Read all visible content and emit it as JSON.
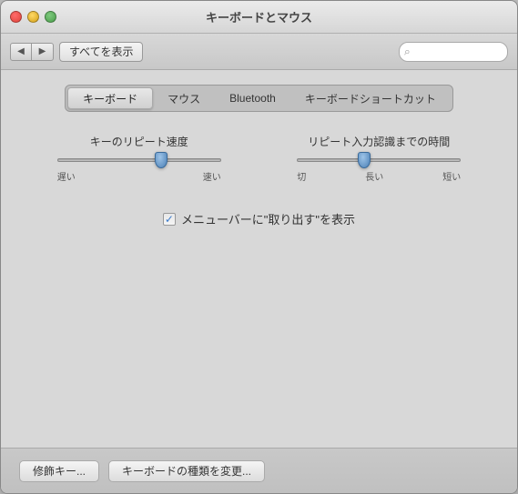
{
  "window": {
    "title": "キーボードとマウス"
  },
  "toolbar": {
    "show_all_label": "すべてを表示",
    "back_label": "◀",
    "forward_label": "▶",
    "search_placeholder": ""
  },
  "tabs": [
    {
      "id": "keyboard",
      "label": "キーボード",
      "active": true
    },
    {
      "id": "mouse",
      "label": "マウス",
      "active": false
    },
    {
      "id": "bluetooth",
      "label": "Bluetooth",
      "active": false
    },
    {
      "id": "shortcuts",
      "label": "キーボードショートカット",
      "active": false
    }
  ],
  "sliders": [
    {
      "id": "repeat-speed",
      "label": "キーのリピート速度",
      "left_label": "遅い",
      "right_label": "速い",
      "value": 65
    },
    {
      "id": "repeat-delay",
      "label": "リピート入力認識までの時間",
      "labels": [
        "切",
        "長い",
        "",
        "",
        "",
        "",
        "短い"
      ],
      "value": 40
    }
  ],
  "checkbox": {
    "checked": true,
    "label": "メニューバーに\"取り出す\"を表示"
  },
  "bottom_buttons": [
    {
      "id": "modifier-keys",
      "label": "修飾キー..."
    },
    {
      "id": "change-keyboard",
      "label": "キーボードの種類を変更..."
    }
  ]
}
